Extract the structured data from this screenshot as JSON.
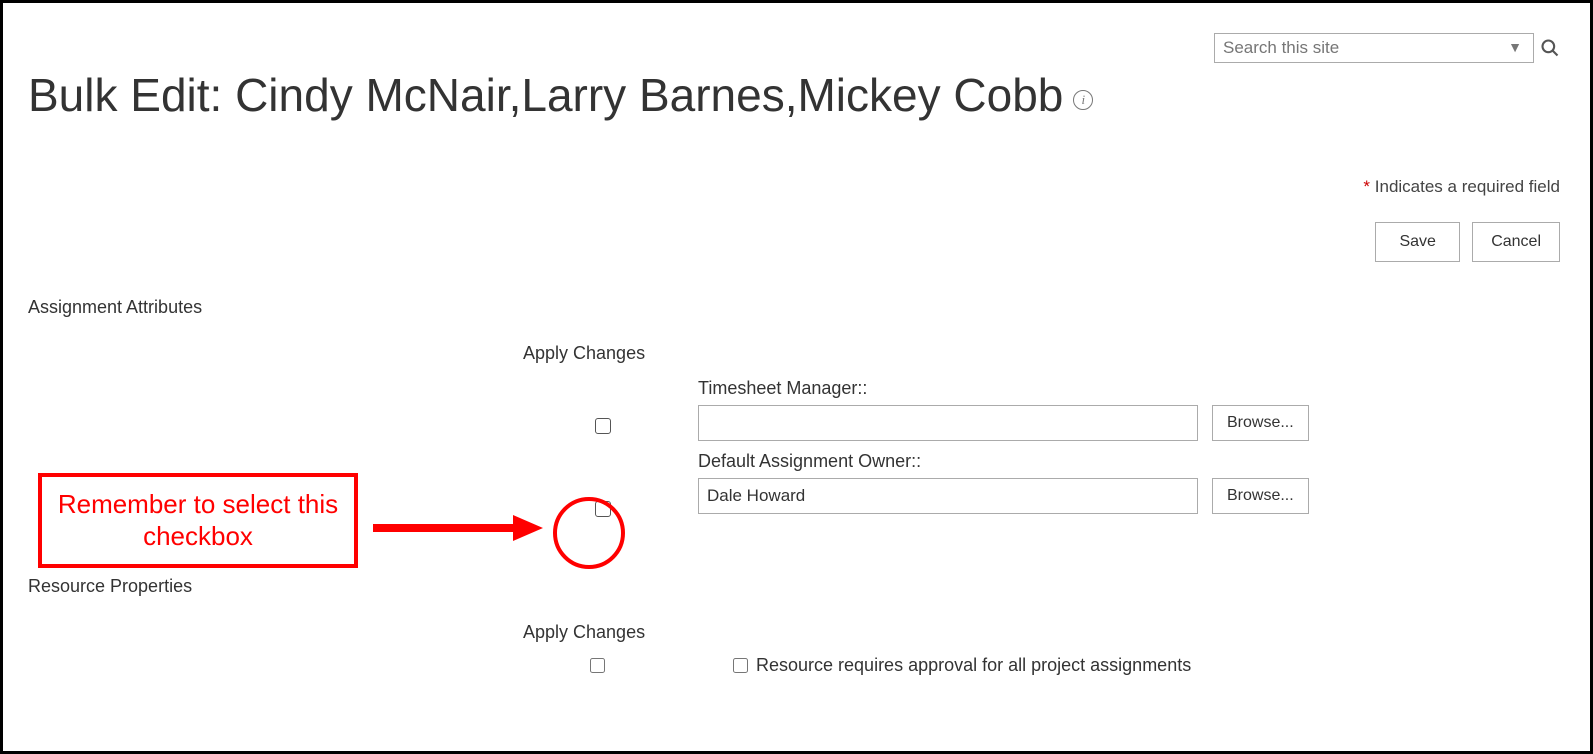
{
  "search": {
    "placeholder": "Search this site"
  },
  "page_title": "Bulk Edit: Cindy McNair,Larry Barnes,Mickey Cobb",
  "required_note": "Indicates a required field",
  "buttons": {
    "save": "Save",
    "cancel": "Cancel",
    "browse": "Browse..."
  },
  "sections": {
    "assignment": {
      "title": "Assignment Attributes",
      "apply_header": "Apply Changes",
      "fields": {
        "timesheet_manager": {
          "label": "Timesheet Manager::",
          "value": ""
        },
        "default_owner": {
          "label": "Default Assignment Owner::",
          "value": "Dale Howard"
        }
      }
    },
    "resource": {
      "title": "Resource Properties",
      "apply_header": "Apply Changes",
      "requires_approval_label": "Resource requires approval for all project assignments"
    }
  },
  "annotation": {
    "text": "Remember to select this checkbox"
  }
}
